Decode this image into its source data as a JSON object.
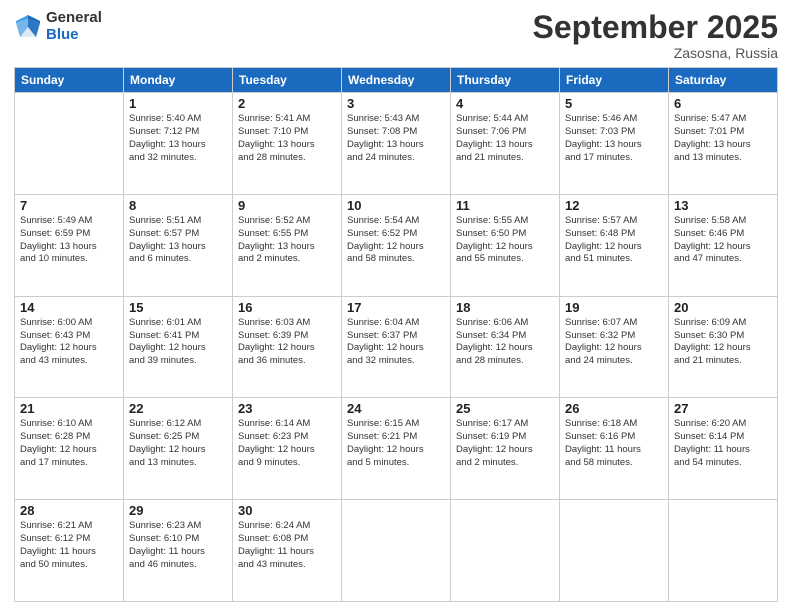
{
  "logo": {
    "general": "General",
    "blue": "Blue"
  },
  "title": {
    "month": "September 2025",
    "location": "Zasosna, Russia"
  },
  "headers": [
    "Sunday",
    "Monday",
    "Tuesday",
    "Wednesday",
    "Thursday",
    "Friday",
    "Saturday"
  ],
  "weeks": [
    [
      {
        "day": "",
        "info": ""
      },
      {
        "day": "1",
        "info": "Sunrise: 5:40 AM\nSunset: 7:12 PM\nDaylight: 13 hours\nand 32 minutes."
      },
      {
        "day": "2",
        "info": "Sunrise: 5:41 AM\nSunset: 7:10 PM\nDaylight: 13 hours\nand 28 minutes."
      },
      {
        "day": "3",
        "info": "Sunrise: 5:43 AM\nSunset: 7:08 PM\nDaylight: 13 hours\nand 24 minutes."
      },
      {
        "day": "4",
        "info": "Sunrise: 5:44 AM\nSunset: 7:06 PM\nDaylight: 13 hours\nand 21 minutes."
      },
      {
        "day": "5",
        "info": "Sunrise: 5:46 AM\nSunset: 7:03 PM\nDaylight: 13 hours\nand 17 minutes."
      },
      {
        "day": "6",
        "info": "Sunrise: 5:47 AM\nSunset: 7:01 PM\nDaylight: 13 hours\nand 13 minutes."
      }
    ],
    [
      {
        "day": "7",
        "info": "Sunrise: 5:49 AM\nSunset: 6:59 PM\nDaylight: 13 hours\nand 10 minutes."
      },
      {
        "day": "8",
        "info": "Sunrise: 5:51 AM\nSunset: 6:57 PM\nDaylight: 13 hours\nand 6 minutes."
      },
      {
        "day": "9",
        "info": "Sunrise: 5:52 AM\nSunset: 6:55 PM\nDaylight: 13 hours\nand 2 minutes."
      },
      {
        "day": "10",
        "info": "Sunrise: 5:54 AM\nSunset: 6:52 PM\nDaylight: 12 hours\nand 58 minutes."
      },
      {
        "day": "11",
        "info": "Sunrise: 5:55 AM\nSunset: 6:50 PM\nDaylight: 12 hours\nand 55 minutes."
      },
      {
        "day": "12",
        "info": "Sunrise: 5:57 AM\nSunset: 6:48 PM\nDaylight: 12 hours\nand 51 minutes."
      },
      {
        "day": "13",
        "info": "Sunrise: 5:58 AM\nSunset: 6:46 PM\nDaylight: 12 hours\nand 47 minutes."
      }
    ],
    [
      {
        "day": "14",
        "info": "Sunrise: 6:00 AM\nSunset: 6:43 PM\nDaylight: 12 hours\nand 43 minutes."
      },
      {
        "day": "15",
        "info": "Sunrise: 6:01 AM\nSunset: 6:41 PM\nDaylight: 12 hours\nand 39 minutes."
      },
      {
        "day": "16",
        "info": "Sunrise: 6:03 AM\nSunset: 6:39 PM\nDaylight: 12 hours\nand 36 minutes."
      },
      {
        "day": "17",
        "info": "Sunrise: 6:04 AM\nSunset: 6:37 PM\nDaylight: 12 hours\nand 32 minutes."
      },
      {
        "day": "18",
        "info": "Sunrise: 6:06 AM\nSunset: 6:34 PM\nDaylight: 12 hours\nand 28 minutes."
      },
      {
        "day": "19",
        "info": "Sunrise: 6:07 AM\nSunset: 6:32 PM\nDaylight: 12 hours\nand 24 minutes."
      },
      {
        "day": "20",
        "info": "Sunrise: 6:09 AM\nSunset: 6:30 PM\nDaylight: 12 hours\nand 21 minutes."
      }
    ],
    [
      {
        "day": "21",
        "info": "Sunrise: 6:10 AM\nSunset: 6:28 PM\nDaylight: 12 hours\nand 17 minutes."
      },
      {
        "day": "22",
        "info": "Sunrise: 6:12 AM\nSunset: 6:25 PM\nDaylight: 12 hours\nand 13 minutes."
      },
      {
        "day": "23",
        "info": "Sunrise: 6:14 AM\nSunset: 6:23 PM\nDaylight: 12 hours\nand 9 minutes."
      },
      {
        "day": "24",
        "info": "Sunrise: 6:15 AM\nSunset: 6:21 PM\nDaylight: 12 hours\nand 5 minutes."
      },
      {
        "day": "25",
        "info": "Sunrise: 6:17 AM\nSunset: 6:19 PM\nDaylight: 12 hours\nand 2 minutes."
      },
      {
        "day": "26",
        "info": "Sunrise: 6:18 AM\nSunset: 6:16 PM\nDaylight: 11 hours\nand 58 minutes."
      },
      {
        "day": "27",
        "info": "Sunrise: 6:20 AM\nSunset: 6:14 PM\nDaylight: 11 hours\nand 54 minutes."
      }
    ],
    [
      {
        "day": "28",
        "info": "Sunrise: 6:21 AM\nSunset: 6:12 PM\nDaylight: 11 hours\nand 50 minutes."
      },
      {
        "day": "29",
        "info": "Sunrise: 6:23 AM\nSunset: 6:10 PM\nDaylight: 11 hours\nand 46 minutes."
      },
      {
        "day": "30",
        "info": "Sunrise: 6:24 AM\nSunset: 6:08 PM\nDaylight: 11 hours\nand 43 minutes."
      },
      {
        "day": "",
        "info": ""
      },
      {
        "day": "",
        "info": ""
      },
      {
        "day": "",
        "info": ""
      },
      {
        "day": "",
        "info": ""
      }
    ]
  ]
}
